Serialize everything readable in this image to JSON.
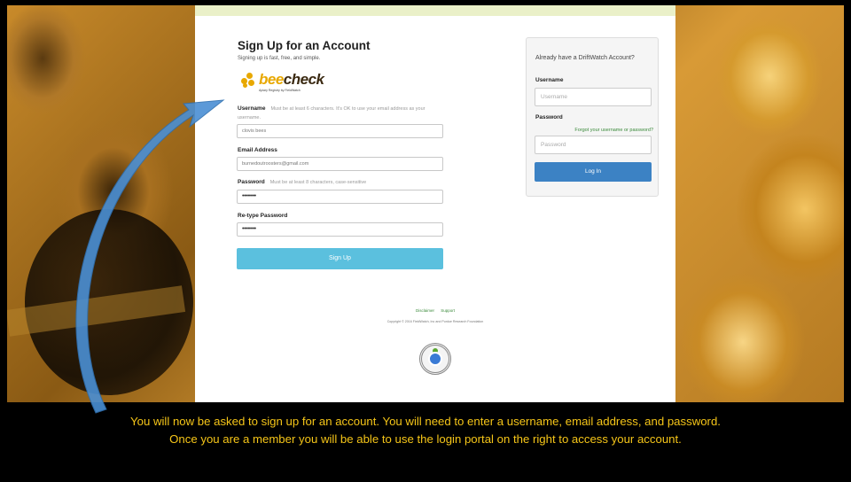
{
  "form": {
    "title": "Sign Up for an Account",
    "subtitle": "Signing up is fast, free, and simple.",
    "logo": {
      "brand_prefix": "bee",
      "brand_suffix": "check",
      "tagline": "Apiary Registry by FieldWatch"
    },
    "username": {
      "label": "Username",
      "hint": "Must be at least 6 characters. It's OK to use your email address as your",
      "hint2": "username.",
      "value": "clovis bees"
    },
    "email": {
      "label": "Email Address",
      "value": "burnedoutroosters@gmail.com"
    },
    "password": {
      "label": "Password",
      "hint": "Must be at least 8 characters, case-sensitive",
      "value": "••••••••"
    },
    "retype": {
      "label": "Re-type Password",
      "value": "••••••••"
    },
    "submit_label": "Sign Up"
  },
  "footer": {
    "links": [
      "Disclaimer",
      "Support"
    ],
    "copyright": "Copyright © 2016 FieldWatch, Inc and Purdue Research Foundation",
    "seal_label": "POSITIVE SSL"
  },
  "login": {
    "title": "Already have a DriftWatch Account?",
    "username_label": "Username",
    "username_placeholder": "Username",
    "password_label": "Password",
    "forgot_link": "Forgot your username or password?",
    "password_placeholder": "Password",
    "button_label": "Log In"
  },
  "caption": {
    "line1": "You will now be asked to sign up for an account.  You will need to enter a username, email address, and password.",
    "line2": "Once you are a member you will be able to use the login portal on the right to access your account."
  },
  "colors": {
    "caption": "#f5c518",
    "signup_button": "#5bc0de",
    "login_button": "#3c82c4",
    "arrow": "#4a8fd4"
  }
}
